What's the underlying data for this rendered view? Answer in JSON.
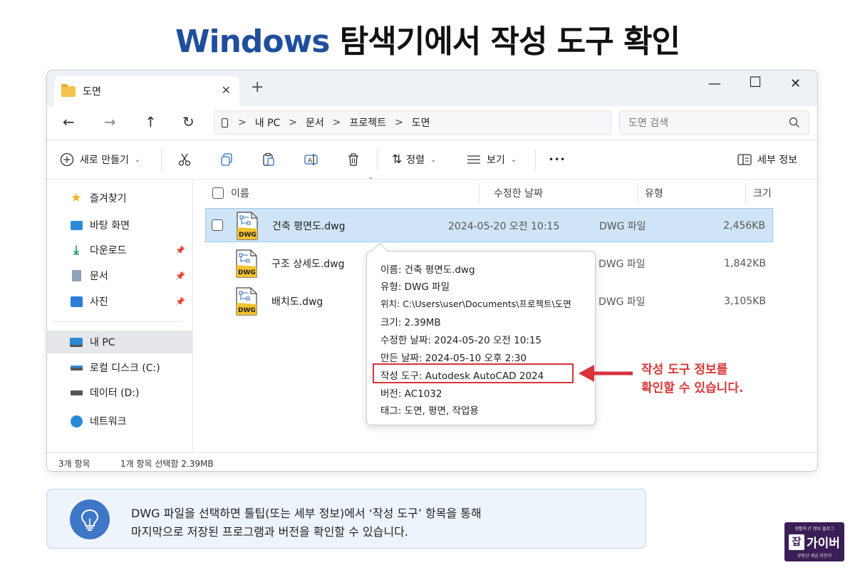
{
  "headline": {
    "en": "Windows",
    "ko": "탐색기에서 작성 도구 확인"
  },
  "tab": {
    "label": "도면",
    "close": "✕",
    "add": "+"
  },
  "window_controls": {
    "minimize": "—",
    "maximize": "☐",
    "close": "✕"
  },
  "nav": {
    "back": "←",
    "forward": "→",
    "up": "↑",
    "refresh": "↻"
  },
  "address": {
    "crumbs": [
      "내 PC",
      "문서",
      "프로젝트",
      "도면"
    ],
    "sep": ">"
  },
  "search": {
    "placeholder": "도면 검색"
  },
  "toolbar": {
    "new_label": "새로 만들기",
    "sort_label": "정렬",
    "view_label": "보기",
    "more": "•••",
    "details_label": "세부 정보"
  },
  "sidebar": {
    "favorites": "즐겨찾기",
    "desktop": "바탕 화면",
    "downloads": "다운로드",
    "documents": "문서",
    "pictures": "사진",
    "this_pc": "내 PC",
    "local_disk": "로컬 디스크 (C:)",
    "data_disk": "데이터 (D:)",
    "network": "네트워크"
  },
  "columns": {
    "name": "이름",
    "modified": "수정한 날짜",
    "type": "유형",
    "size": "크기"
  },
  "files": [
    {
      "name": "건축 평면도.dwg",
      "modified": "2024-05-20 오전 10:15",
      "type": "DWG 파일",
      "size": "2,456KB"
    },
    {
      "name": "구조 상세도.dwg",
      "modified": "",
      "type": "DWG 파일",
      "size": "1,842KB"
    },
    {
      "name": "배치도.dwg",
      "modified": "",
      "type": "DWG 파일",
      "size": "3,105KB"
    }
  ],
  "file_icon_label": "DWG",
  "tooltip": {
    "name": "이름: 건축 평면도.dwg",
    "type": "유형: DWG 파일",
    "location": "위치: C:\\Users\\user\\Documents\\프로젝트\\도면",
    "size": "크기: 2.39MB",
    "modified": "수정한 날짜: 2024-05-20 오전 10:15",
    "created": "만든 날짜: 2024-05-10 오후 2:30",
    "author_tool": "작성 도구: Autodesk AutoCAD 2024",
    "version": "버전: AC1032",
    "tags": "태그: 도면, 평면, 작업용"
  },
  "callout": {
    "line1": "작성 도구 정보를",
    "line2": "확인할 수 있습니다."
  },
  "status": {
    "count": "3개 항목",
    "selection": "1개 항목 선택함  2.39MB"
  },
  "info": {
    "line1": "DWG 파일을 선택하면 툴팁(또는 세부 정보)에서 ‘작성 도구’ 항목을 통해",
    "line2": "마지막으로 저장된 프로그램과 버전을 확인할 수 있습니다."
  },
  "logo": {
    "top": "생활의 IT 정보 블로그",
    "box": "잡",
    "main": "가이버",
    "bottom": "부동산 세금 자전거"
  },
  "colors": {
    "accent": "#1f4e9c",
    "selection": "#cfe5f7",
    "highlight": "#d6333a",
    "folder": "#f4c34d",
    "dwg_yellow": "#f2c230"
  }
}
